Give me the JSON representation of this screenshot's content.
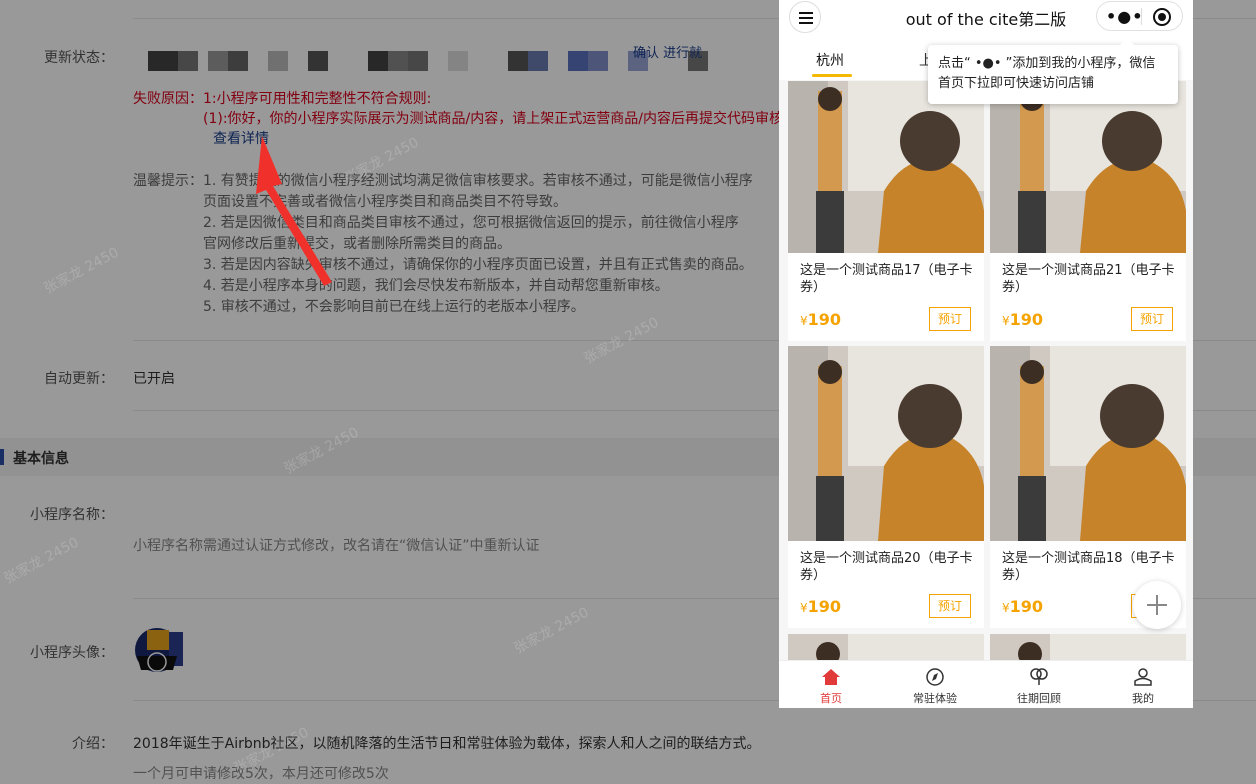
{
  "admin": {
    "update_status": {
      "label": "更新状态：",
      "fragment": "确认 进行就"
    },
    "fail": {
      "label": "失败原因：",
      "rule": "1:小程序可用性和完整性不符合规则:",
      "detail": "(1):你好，你的小程序实际展示为测试商品/内容，请上架正式运营商品/内容后再提交代码审核",
      "link": "查看详情"
    },
    "tips": {
      "label": "温馨提示：",
      "lines": [
        "1. 有赞提交的微信小程序经测试均满足微信审核要求。若审核不通过，可能是微信小程序",
        "页面设置不完善或者微信小程序类目和商品类目不符导致。",
        "2. 若是因微信类目和商品类目审核不通过，您可根据微信返回的提示，前往微信小程序",
        "官网修改后重新提交，或者删除所需类目的商品。",
        "3. 若是因内容缺失审核不通过，请确保你的小程序页面已设置，并且有正式售卖的商品。",
        "4. 若是小程序本身的问题，我们会尽快发布新版本，并自动帮您重新审核。",
        "5. 审核不通过，不会影响目前已在线上运行的老版本小程序。"
      ]
    },
    "auto_update": {
      "label": "自动更新：",
      "value": "已开启"
    },
    "section_title": "基本信息",
    "name": {
      "label": "小程序名称：",
      "hint": "小程序名称需通过认证方式修改，改名请在“微信认证”中重新认证"
    },
    "avatar": {
      "label": "小程序头像："
    },
    "intro": {
      "label": "介绍：",
      "value": "2018年诞生于Airbnb社区，以随机降落的生活节日和常驻体验为载体，探索人和人之间的联结方式。",
      "hint": "一个月可申请修改5次，本月还可修改5次"
    },
    "watermark": "张家龙 2450"
  },
  "phone": {
    "title": "out of the cite第二版",
    "capsule_dots": "•●•",
    "tabs": [
      "杭州",
      "上"
    ],
    "tooltip": "点击“ •●• ”添加到我的小程序，微信首页下拉即可快速访问店铺",
    "currency": "¥",
    "products": [
      {
        "name": "这是一个测试商品17（电子卡券）",
        "price": "190",
        "action": "预订"
      },
      {
        "name": "这是一个测试商品21（电子卡券）",
        "price": "190",
        "action": "预订"
      },
      {
        "name": "这是一个测试商品20（电子卡券）",
        "price": "190",
        "action": "预订"
      },
      {
        "name": "这是一个测试商品18（电子卡券）",
        "price": "190",
        "action": "预订"
      }
    ],
    "nav": [
      {
        "label": "首页",
        "icon": "home-icon",
        "active": true
      },
      {
        "label": "常驻体验",
        "icon": "compass-icon",
        "active": false
      },
      {
        "label": "往期回顾",
        "icon": "balloon-icon",
        "active": false
      },
      {
        "label": "我的",
        "icon": "user-icon",
        "active": false
      }
    ],
    "colors": {
      "accent": "#f5a300",
      "tab_line": "#f5b800",
      "nav_active": "#e03a3a"
    }
  }
}
